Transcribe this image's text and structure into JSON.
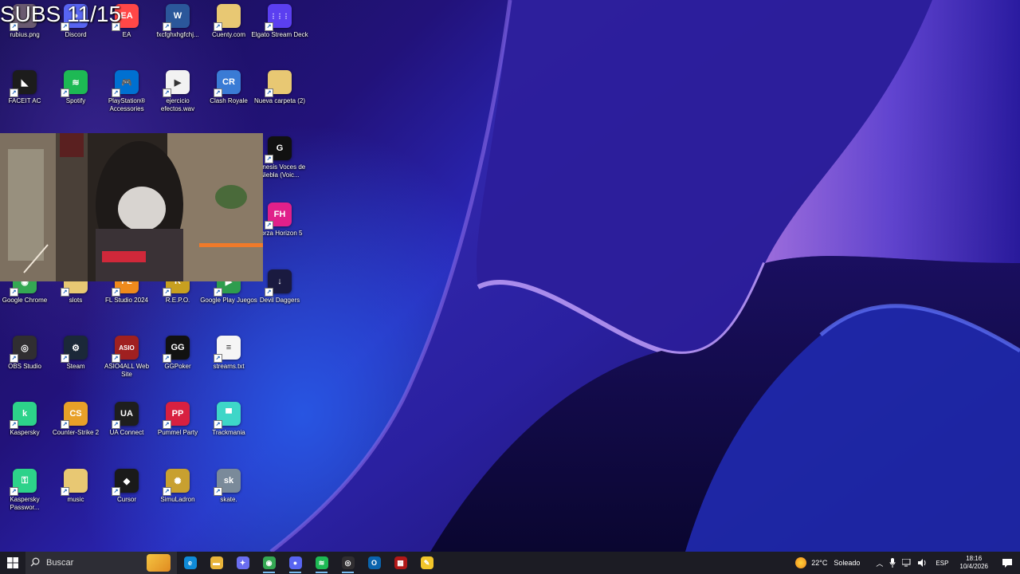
{
  "overlay": {
    "subs_text": "SUBS 11/15"
  },
  "desktop_icons": [
    {
      "id": "rubius",
      "label": "rubius.png",
      "glyph": "",
      "color": "#6a5a70",
      "icon": "image-file-icon"
    },
    {
      "id": "discord",
      "label": "Discord",
      "glyph": "●",
      "color": "#5865f2",
      "icon": "discord-icon"
    },
    {
      "id": "ea",
      "label": "EA",
      "glyph": "EA",
      "color": "#ff4747",
      "icon": "ea-icon"
    },
    {
      "id": "word",
      "label": "fxcfghxhgfchj...",
      "glyph": "W",
      "color": "#2b579a",
      "icon": "word-document-icon"
    },
    {
      "id": "cuenty",
      "label": "Cuenty.com",
      "glyph": "",
      "color": "#e8c873",
      "icon": "folder-icon"
    },
    {
      "id": "elgato",
      "label": "Elgato Stream Deck",
      "glyph": "⋮⋮⋮",
      "color": "#5b3ff0",
      "icon": "stream-deck-icon"
    },
    {
      "id": "faceit",
      "label": "FACEIT AC",
      "glyph": "◣",
      "color": "#1c1c1c",
      "icon": "faceit-icon"
    },
    {
      "id": "spotify",
      "label": "Spotify",
      "glyph": "≋",
      "color": "#1db954",
      "icon": "spotify-icon"
    },
    {
      "id": "psaccessories",
      "label": "PlayStation® Accessories",
      "glyph": "🎮",
      "color": "#0070d1",
      "icon": "playstation-icon"
    },
    {
      "id": "ejercicio",
      "label": "ejercicio efectos.wav",
      "glyph": "▶",
      "color": "#f2f2f2",
      "icon": "audio-file-icon"
    },
    {
      "id": "clash",
      "label": "Clash Royale",
      "glyph": "CR",
      "color": "#3a7bd5",
      "icon": "clash-royale-icon"
    },
    {
      "id": "nuevacarpeta",
      "label": "Nueva carpeta (2)",
      "glyph": "",
      "color": "#e8c873",
      "icon": "folder-icon"
    },
    {
      "id": "genesis",
      "label": "Genesis Voces de Niebla (Voic...",
      "glyph": "G",
      "color": "#111111",
      "icon": "game-icon"
    },
    {
      "id": "forza",
      "label": "Forza Horizon 5",
      "glyph": "FH",
      "color": "#e0208a",
      "icon": "forza-icon"
    },
    {
      "id": "chrome",
      "label": "Google Chrome",
      "glyph": "◉",
      "color": "#34a853",
      "icon": "chrome-icon"
    },
    {
      "id": "slots",
      "label": "slots",
      "glyph": "",
      "color": "#e8c873",
      "icon": "folder-icon"
    },
    {
      "id": "flstudio",
      "label": "FL Studio 2024",
      "glyph": "FL",
      "color": "#f08a1c",
      "icon": "fl-studio-icon"
    },
    {
      "id": "repo",
      "label": "R.E.P.O.",
      "glyph": "R",
      "color": "#c8a020",
      "icon": "repo-icon"
    },
    {
      "id": "googleplay",
      "label": "Google Play Juegos",
      "glyph": "▶",
      "color": "#2e9d4e",
      "icon": "google-play-icon"
    },
    {
      "id": "devildaggers",
      "label": "Devil Daggers",
      "glyph": "↓",
      "color": "#1a1a40",
      "icon": "dagger-icon"
    },
    {
      "id": "obs",
      "label": "OBS Studio",
      "glyph": "◎",
      "color": "#302e31",
      "icon": "obs-icon"
    },
    {
      "id": "steam",
      "label": "Steam",
      "glyph": "⚙",
      "color": "#1b2838",
      "icon": "steam-icon"
    },
    {
      "id": "asio",
      "label": "ASIO4ALL Web Site",
      "glyph": "ASIO",
      "color": "#a02020",
      "icon": "asio-icon"
    },
    {
      "id": "ggpoker",
      "label": "GGPoker",
      "glyph": "GG",
      "color": "#111111",
      "icon": "ggpoker-icon"
    },
    {
      "id": "streams",
      "label": "streams.txt",
      "glyph": "≡",
      "color": "#f5f5f5",
      "icon": "text-file-icon"
    },
    {
      "id": "kaspersky",
      "label": "Kaspersky",
      "glyph": "k",
      "color": "#2dd28a",
      "icon": "kaspersky-icon"
    },
    {
      "id": "cs2",
      "label": "Counter-Strike 2",
      "glyph": "CS",
      "color": "#e8a028",
      "icon": "counter-strike-icon"
    },
    {
      "id": "uaconnect",
      "label": "UA Connect",
      "glyph": "UA",
      "color": "#1e1e1e",
      "icon": "ua-connect-icon"
    },
    {
      "id": "pummel",
      "label": "Pummel Party",
      "glyph": "PP",
      "color": "#d82040",
      "icon": "pummel-party-icon"
    },
    {
      "id": "trackmania",
      "label": "Trackmania",
      "glyph": "▀",
      "color": "#3ed6c8",
      "icon": "trackmania-icon"
    },
    {
      "id": "kasperskypw",
      "label": "Kaspersky Passwor...",
      "glyph": "⚿",
      "color": "#2dd28a",
      "icon": "kaspersky-password-icon"
    },
    {
      "id": "music",
      "label": "music",
      "glyph": "",
      "color": "#e8c873",
      "icon": "folder-icon"
    },
    {
      "id": "cursor",
      "label": "Cursor",
      "glyph": "◆",
      "color": "#1a1a1a",
      "icon": "cursor-app-icon"
    },
    {
      "id": "simuladron",
      "label": "SimuLadron",
      "glyph": "✺",
      "color": "#c8a030",
      "icon": "simuladron-icon"
    },
    {
      "id": "skate",
      "label": "skate.",
      "glyph": "sk",
      "color": "#7a8a9a",
      "icon": "skate-icon"
    }
  ],
  "taskbar": {
    "search_placeholder": "Buscar",
    "apps": [
      {
        "name": "edge",
        "icon": "edge-icon",
        "glyph": "e",
        "color": "#0f8bd8"
      },
      {
        "name": "file-explorer",
        "icon": "folder-icon",
        "glyph": "▬",
        "color": "#e8b43a"
      },
      {
        "name": "copilot",
        "icon": "copilot-icon",
        "glyph": "✦",
        "color": "#6a6ef0"
      },
      {
        "name": "chrome",
        "icon": "chrome-icon",
        "glyph": "◉",
        "color": "#34a853"
      },
      {
        "name": "discord",
        "icon": "discord-icon",
        "glyph": "●",
        "color": "#5865f2"
      },
      {
        "name": "spotify",
        "icon": "spotify-icon",
        "glyph": "≋",
        "color": "#1db954"
      },
      {
        "name": "obs",
        "icon": "obs-icon",
        "glyph": "◎",
        "color": "#302e31"
      },
      {
        "name": "outlook",
        "icon": "outlook-icon",
        "glyph": "O",
        "color": "#0a64ad"
      },
      {
        "name": "video-app",
        "icon": "video-app-icon",
        "glyph": "▦",
        "color": "#b01818"
      },
      {
        "name": "notes",
        "icon": "notes-icon",
        "glyph": "✎",
        "color": "#f2c52a"
      }
    ],
    "weather": {
      "temp": "22°C",
      "condition": "Soleado"
    },
    "language": "ESP",
    "time": "18:16",
    "date": "10/4/2026"
  }
}
